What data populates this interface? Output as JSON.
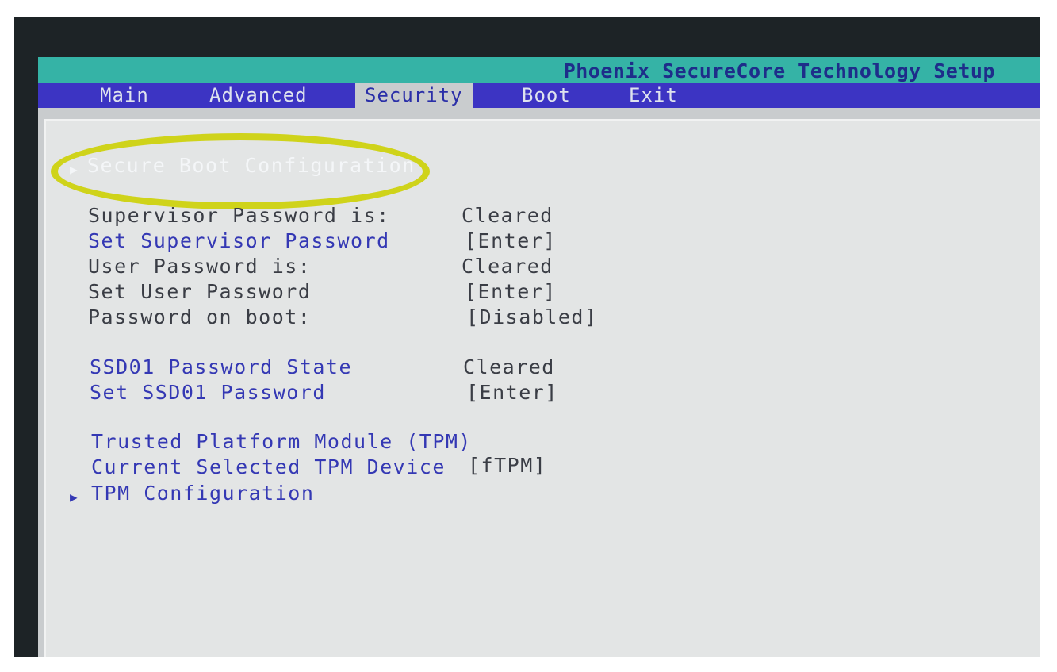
{
  "title": "Phoenix SecureCore Technology Setup",
  "menu": {
    "main": "Main",
    "advanced": "Advanced",
    "security": "Security",
    "boot": "Boot",
    "exit": "Exit"
  },
  "items": {
    "secure_boot": "Secure Boot Configuration",
    "supervisor_status_label": "Supervisor Password is:",
    "supervisor_status_value": "Cleared",
    "set_supervisor_label": "Set Supervisor Password",
    "set_supervisor_value": "[Enter]",
    "user_status_label": "User Password is:",
    "user_status_value": "Cleared",
    "set_user_label": "Set User Password",
    "set_user_value": "[Enter]",
    "password_on_boot_label": "Password on boot:",
    "password_on_boot_value": "[Disabled]",
    "ssd_state_label": "SSD01 Password State",
    "ssd_state_value": "Cleared",
    "set_ssd_label": "Set SSD01 Password",
    "set_ssd_value": "[Enter]",
    "tpm_label": "Trusted Platform Module (TPM)",
    "tpm_device_label": "Current Selected TPM Device",
    "tpm_device_value": "[fTPM]",
    "tpm_config": "TPM Configuration"
  },
  "icons": {
    "submenu_arrow": "triangle-right-icon"
  },
  "colors": {
    "title_bar": "#35b3a6",
    "menu_bar": "#3c34c3",
    "panel": "#e3e5e5",
    "highlight": "#cfd31a",
    "blue_text": "#3438b4"
  }
}
